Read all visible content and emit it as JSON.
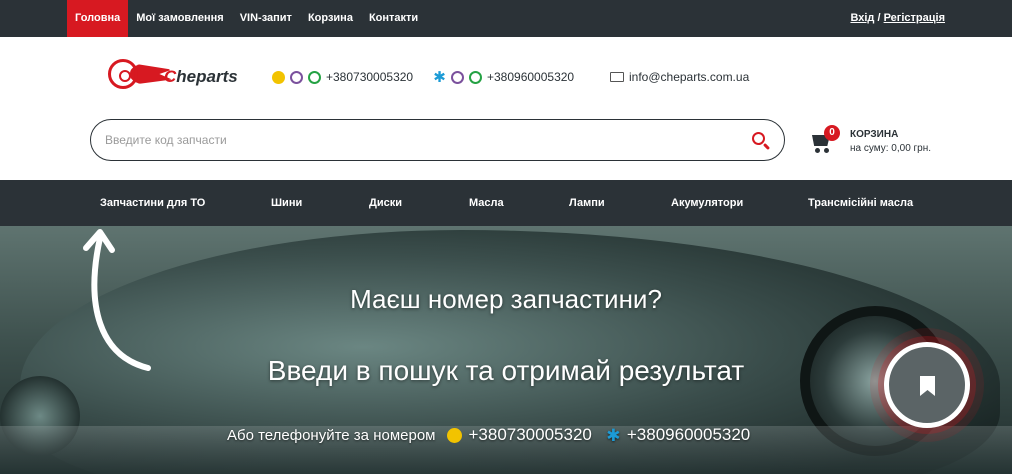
{
  "topbar": {
    "nav": [
      "Головна",
      "Мої замовлення",
      "VIN-запит",
      "Корзина",
      "Контакти"
    ],
    "auth_login": "Вхід",
    "auth_sep": " / ",
    "auth_register": "Регістрація"
  },
  "header": {
    "logo_text_highlight": "C",
    "logo_text": "heparts",
    "phone1": "+380730005320",
    "phone2": "+380960005320",
    "email": "info@cheparts.com.ua",
    "icons": [
      "lifecell-icon",
      "viber-icon",
      "whatsapp-icon",
      "kyivstar-icon",
      "mail-icon"
    ]
  },
  "search": {
    "placeholder": "Введите код запчасти"
  },
  "cart": {
    "count": "0",
    "title": "КОРЗИНА",
    "sum": "на суму: 0,00 грн."
  },
  "categories": [
    "Запчастини для ТО",
    "Шини",
    "Диски",
    "Масла",
    "Лампи",
    "Акумулятори",
    "Трансмісійні масла"
  ],
  "hero": {
    "headline": "Маєш номер запчастини?",
    "subheadline": "Введи в пошук та отримай результат",
    "call_label": "Або телефонуйте за номером",
    "phone1": "+380730005320",
    "phone2": "+380960005320"
  },
  "colors": {
    "accent": "#d71921",
    "dark": "#2b3237"
  }
}
